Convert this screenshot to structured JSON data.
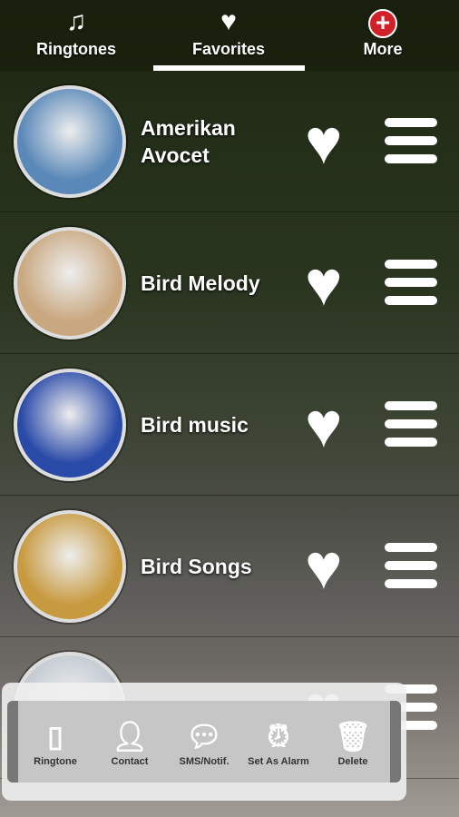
{
  "tabs": [
    {
      "label": "Ringtones",
      "icon": "music-note-icon"
    },
    {
      "label": "Favorites",
      "icon": "heart-icon",
      "active": true
    },
    {
      "label": "More",
      "icon": "plus-badge-icon"
    }
  ],
  "items": [
    {
      "title": "Amerikan Avocet",
      "avatar_color": "#5a88b8"
    },
    {
      "title": "Bird Melody",
      "avatar_color": "#c9a880"
    },
    {
      "title": "Bird music",
      "avatar_color": "#2a4aa8"
    },
    {
      "title": "Bird Songs",
      "avatar_color": "#c89a40"
    },
    {
      "title": "",
      "avatar_color": "#c0c8d0"
    }
  ],
  "actions": [
    {
      "label": "Ringtone",
      "icon": "phone-icon"
    },
    {
      "label": "Contact",
      "icon": "contact-icon"
    },
    {
      "label": "SMS/Notif.",
      "icon": "chat-bubble-icon"
    },
    {
      "label": "Set As Alarm",
      "icon": "alarm-clock-icon"
    },
    {
      "label": "Delete",
      "icon": "trash-icon"
    }
  ]
}
